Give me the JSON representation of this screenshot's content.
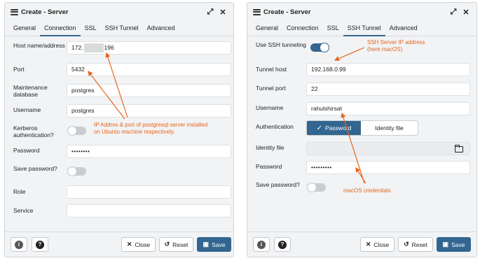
{
  "left": {
    "title": "Create - Server",
    "tabs": [
      {
        "label": "General"
      },
      {
        "label": "Connection"
      },
      {
        "label": "SSL"
      },
      {
        "label": "SSH Tunnel"
      },
      {
        "label": "Advanced"
      }
    ],
    "fields": {
      "host_label": "Host name/address",
      "host_value_prefix": "172.",
      "host_value_suffix": "196",
      "port_label": "Port",
      "port_value": "5432",
      "maintenance_label": "Maintenance database",
      "maintenance_value": "postgres",
      "username_label": "Username",
      "username_value": "postgres",
      "kerberos_label": "Kerberos authentication?",
      "kerberos_on": false,
      "password_label": "Password",
      "password_value": "••••••••",
      "save_password_label": "Save password?",
      "save_password_on": false,
      "role_label": "Role",
      "role_value": "",
      "service_label": "Service",
      "service_value": ""
    },
    "footer": {
      "close": "Close",
      "reset": "Reset",
      "save": "Save"
    }
  },
  "right": {
    "title": "Create - Server",
    "tabs": [
      {
        "label": "General"
      },
      {
        "label": "Connection"
      },
      {
        "label": "SSL"
      },
      {
        "label": "SSH Tunnel"
      },
      {
        "label": "Advanced"
      }
    ],
    "fields": {
      "use_ssh_label": "Use SSH tunneling",
      "use_ssh_on": true,
      "tunnel_host_label": "Tunnel host",
      "tunnel_host_value": "192.168.0.99",
      "tunnel_port_label": "Tunnel port",
      "tunnel_port_value": "22",
      "username_label": "Username",
      "username_value": "rahulshirsat",
      "auth_label": "Authentication",
      "auth_option_password": "Password",
      "auth_option_identity": "Identity file",
      "identity_label": "Identity file",
      "password_label": "Password",
      "password_value": "•••••••••",
      "save_password_label": "Save password?",
      "save_password_on": false
    },
    "footer": {
      "close": "Close",
      "reset": "Reset",
      "save": "Save"
    }
  },
  "annotations": {
    "ip_port_line1": "IP Addres & port of postgresql server installed",
    "ip_port_line2": "on Ubuntu machine respectively.",
    "ssh_ip_line1": "SSH Server IP address",
    "ssh_ip_line2": "(here macOS)",
    "mac_credentials": "macOS credentials"
  },
  "colors": {
    "accent": "#326690",
    "annotation": "#e8651a"
  },
  "icons": {
    "title": "server-icon",
    "expand": "expand-icon",
    "close": "close-icon",
    "info": "info-icon",
    "help": "help-icon",
    "folder": "folder-icon",
    "check": "check-icon",
    "reset": "reset-icon",
    "save": "save-icon"
  }
}
